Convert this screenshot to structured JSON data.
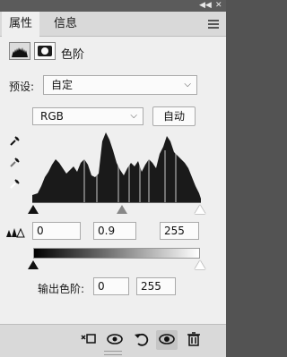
{
  "panel_tabs": [
    {
      "label": "属性"
    },
    {
      "label": "信息"
    }
  ],
  "header": {
    "title": "色阶",
    "histogram_icon": "histogram-icon",
    "mask_icon": "mask-icon"
  },
  "preset": {
    "label": "预设:",
    "value": "自定"
  },
  "channel": {
    "value": "RGB"
  },
  "auto_button": {
    "label": "自动"
  },
  "input_levels": {
    "black": "0",
    "gamma": "0.9",
    "white": "255"
  },
  "output_levels": {
    "label": "输出色阶:",
    "black": "0",
    "white": "255"
  },
  "icons": {
    "eyedropper_black": "eyedropper-black-icon",
    "eyedropper_gray": "eyedropper-gray-icon",
    "eyedropper_white": "eyedropper-white-icon",
    "clip_warning": "clipping-warning-icon",
    "clip_to_layer": "clip-to-layer-icon",
    "view_previous": "view-previous-state-icon",
    "reset": "reset-icon",
    "visibility": "visibility-eye-icon",
    "delete": "trash-icon"
  },
  "colors": {
    "panel_bg": "#efefef",
    "title_bar": "#5b5b5b"
  }
}
